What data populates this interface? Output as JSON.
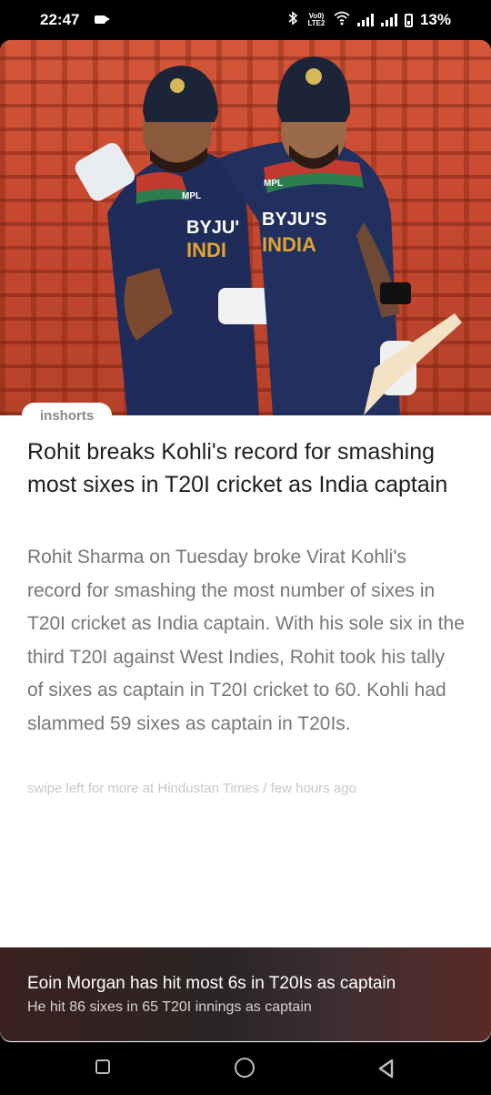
{
  "status_bar": {
    "time": "22:47",
    "network_label": "Vo0) LTE2",
    "battery": "13%"
  },
  "article": {
    "source_tag": "inshorts",
    "headline": "Rohit breaks Kohli's record for smashing most sixes in T20I cricket as India captain",
    "body": "Rohit Sharma on Tuesday broke Virat Kohli's record for smashing the most number of sixes in T20I cricket as India captain. With his sole six in the third T20I against West Indies, Rohit took his tally of sixes as captain in T20I cricket to 60. Kohli had slammed 59 sixes as captain in T20Is.",
    "footer": "swipe left for more at Hindustan Times / few hours ago",
    "image": {
      "jersey_left": "BYJU'S INDIA",
      "jersey_right": "BYJU'S INDIA",
      "sponsor": "MPL"
    }
  },
  "teaser": {
    "title": "Eoin Morgan has hit most 6s in T20Is as captain",
    "subtitle": "He hit 86 sixes in 65 T20I innings as captain"
  },
  "nav": {
    "icons": [
      "recent-apps-icon",
      "home-icon",
      "back-icon"
    ]
  },
  "colors": {
    "stadium": "#c84a30",
    "jersey": "#1f2c5a",
    "teaser_bg": "#2f2526"
  }
}
